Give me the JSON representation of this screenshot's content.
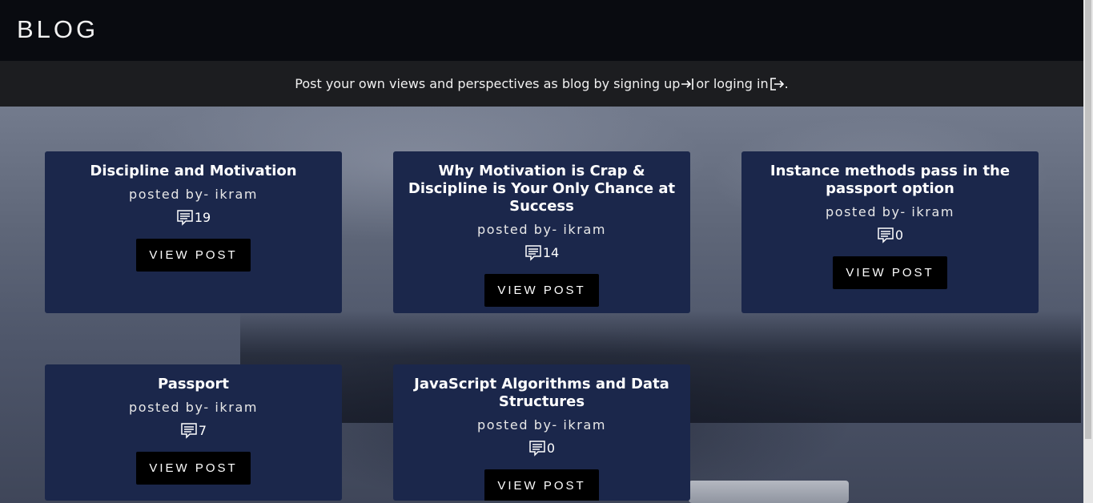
{
  "header": {
    "brand": "BLOG"
  },
  "subbar": {
    "text_before": "Post your own views and perspectives as blog by signing up",
    "text_middle": "or loging in",
    "text_end": "."
  },
  "posts": [
    {
      "title": "Discipline and Motivation",
      "author": "posted by- ikram",
      "comments": "19",
      "button": "VIEW POST"
    },
    {
      "title": "Why Motivation is Crap & Discipline is Your Only Chance at Success",
      "author": "posted by- ikram",
      "comments": "14",
      "button": "VIEW POST"
    },
    {
      "title": "Instance methods pass in the passport option",
      "author": "posted by- ikram",
      "comments": "0",
      "button": "VIEW POST"
    },
    {
      "title": "Passport",
      "author": "posted by- ikram",
      "comments": "7",
      "button": "VIEW POST"
    },
    {
      "title": "JavaScript Algorithms and Data Structures",
      "author": "posted by- ikram",
      "comments": "0",
      "button": "VIEW POST"
    }
  ],
  "icons": {
    "signup": "sign-up-arrow-icon",
    "login": "log-in-arrow-icon",
    "comments": "comment-icon"
  }
}
